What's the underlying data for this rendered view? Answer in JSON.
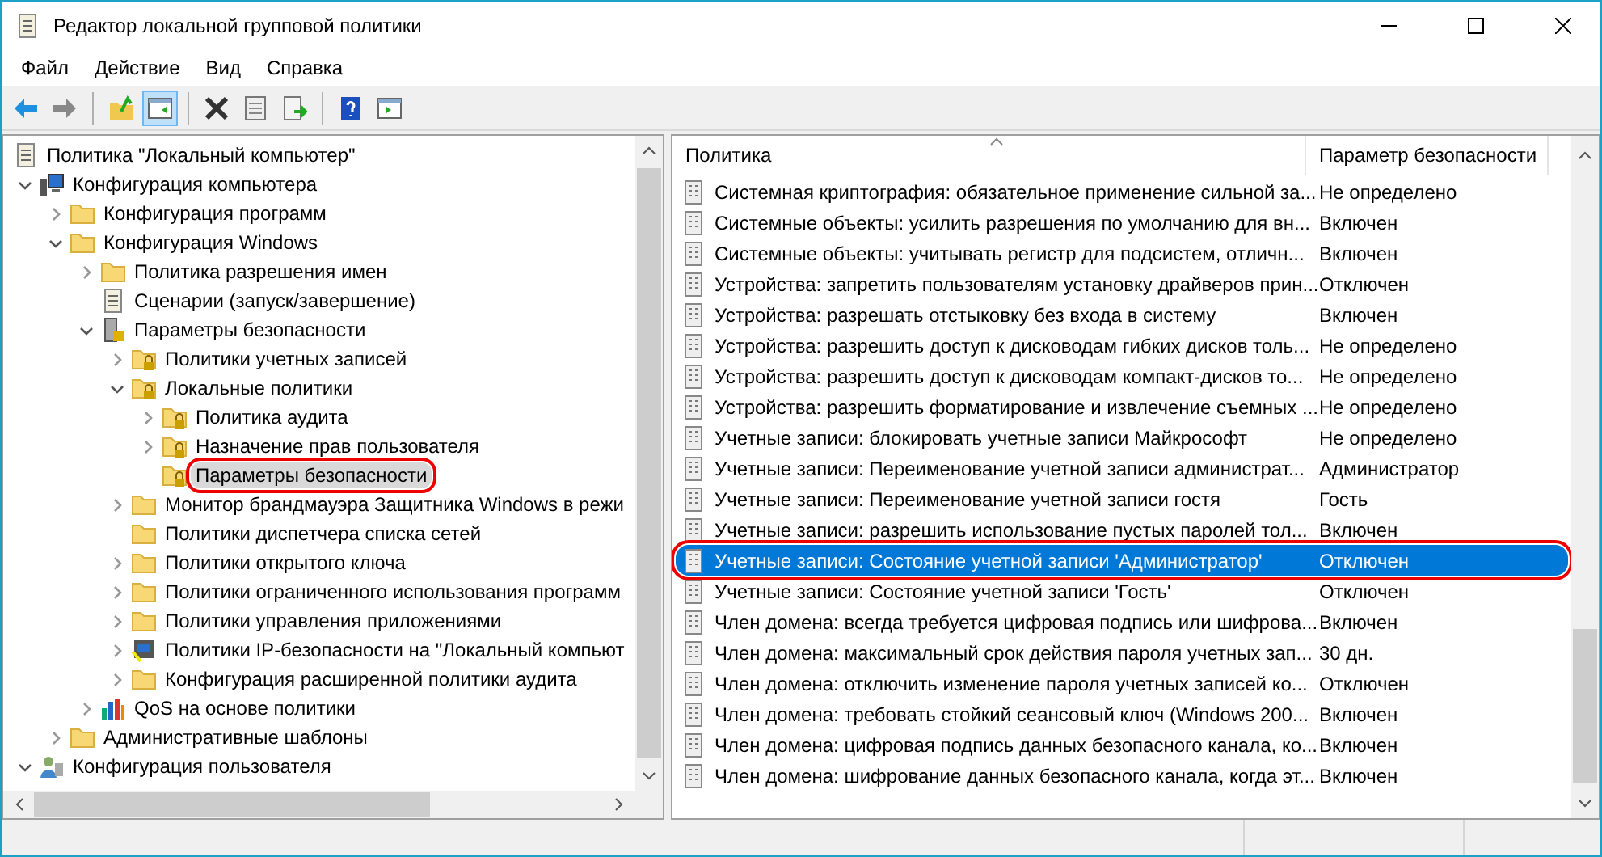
{
  "window": {
    "title": "Редактор локальной групповой политики"
  },
  "menu": [
    "Файл",
    "Действие",
    "Вид",
    "Справка"
  ],
  "toolbar": [
    {
      "kind": "back",
      "pressed": false
    },
    {
      "kind": "forward",
      "pressed": false
    },
    {
      "kind": "separator"
    },
    {
      "kind": "up",
      "pressed": false
    },
    {
      "kind": "tree",
      "pressed": true
    },
    {
      "kind": "separator"
    },
    {
      "kind": "delete",
      "pressed": false
    },
    {
      "kind": "properties",
      "pressed": false
    },
    {
      "kind": "export",
      "pressed": false
    },
    {
      "kind": "separator"
    },
    {
      "kind": "help",
      "pressed": false
    },
    {
      "kind": "actions",
      "pressed": false
    }
  ],
  "tree": [
    {
      "label": "Политика \"Локальный компьютер\"",
      "kind": "doc",
      "selected": false,
      "circled": false,
      "children": [
        {
          "label": "Конфигурация компьютера",
          "kind": "computer",
          "expanded": true,
          "selected": false,
          "circled": false,
          "children": [
            {
              "label": "Конфигурация программ",
              "kind": "folder",
              "expanded": false,
              "selected": false,
              "circled": false
            },
            {
              "label": "Конфигурация Windows",
              "kind": "folder",
              "expanded": true,
              "selected": false,
              "circled": false,
              "children": [
                {
                  "label": "Политика разрешения имен",
                  "kind": "folder",
                  "expanded": false,
                  "selected": false,
                  "circled": false
                },
                {
                  "label": "Сценарии (запуск/завершение)",
                  "kind": "script",
                  "selected": false,
                  "circled": false
                },
                {
                  "label": "Параметры безопасности",
                  "kind": "secure",
                  "expanded": true,
                  "selected": false,
                  "circled": false,
                  "children": [
                    {
                      "label": "Политики учетных записей",
                      "kind": "lockfolder",
                      "expanded": false,
                      "selected": false,
                      "circled": false
                    },
                    {
                      "label": "Локальные политики",
                      "kind": "lockfolder",
                      "expanded": true,
                      "selected": false,
                      "circled": false,
                      "children": [
                        {
                          "label": "Политика аудита",
                          "kind": "lockfolder",
                          "expanded": false,
                          "selected": false,
                          "circled": false
                        },
                        {
                          "label": "Назначение прав пользователя",
                          "kind": "lockfolder",
                          "expanded": false,
                          "selected": false,
                          "circled": false
                        },
                        {
                          "label": "Параметры безопасности",
                          "kind": "lockfolder",
                          "selected": true,
                          "circled": true
                        }
                      ]
                    },
                    {
                      "label": "Монитор брандмауэра Защитника Windows в режи",
                      "kind": "folder",
                      "expanded": false,
                      "selected": false,
                      "circled": false
                    },
                    {
                      "label": "Политики диспетчера списка сетей",
                      "kind": "folder",
                      "selected": false,
                      "circled": false
                    },
                    {
                      "label": "Политики открытого ключа",
                      "kind": "folder",
                      "expanded": false,
                      "selected": false,
                      "circled": false
                    },
                    {
                      "label": "Политики ограниченного использования программ",
                      "kind": "folder",
                      "expanded": false,
                      "selected": false,
                      "circled": false
                    },
                    {
                      "label": "Политики управления приложениями",
                      "kind": "folder",
                      "expanded": false,
                      "selected": false,
                      "circled": false
                    },
                    {
                      "label": "Политики IP-безопасности на \"Локальный компьют",
                      "kind": "ip",
                      "expanded": false,
                      "selected": false,
                      "circled": false
                    },
                    {
                      "label": "Конфигурация расширенной политики аудита",
                      "kind": "folder",
                      "expanded": false,
                      "selected": false,
                      "circled": false
                    }
                  ]
                },
                {
                  "label": "QoS на основе политики",
                  "kind": "qos",
                  "expanded": false,
                  "selected": false,
                  "circled": false
                }
              ]
            },
            {
              "label": "Административные шаблоны",
              "kind": "folder",
              "expanded": false,
              "selected": false,
              "circled": false
            }
          ]
        },
        {
          "label": "Конфигурация пользователя",
          "kind": "user",
          "expanded": true,
          "selected": false,
          "circled": false
        }
      ]
    }
  ],
  "list": {
    "columns": [
      "Политика",
      "Параметр безопасности"
    ],
    "rows": [
      {
        "policy": "Системная криптография: обязательное применение сильной за...",
        "setting": "Не определено",
        "selected": false,
        "circled": false
      },
      {
        "policy": "Системные объекты: усилить разрешения по умолчанию для вн...",
        "setting": "Включен",
        "selected": false,
        "circled": false
      },
      {
        "policy": "Системные объекты: учитывать регистр для подсистем, отличн...",
        "setting": "Включен",
        "selected": false,
        "circled": false
      },
      {
        "policy": "Устройства: запретить пользователям установку драйверов прин...",
        "setting": "Отключен",
        "selected": false,
        "circled": false
      },
      {
        "policy": "Устройства: разрешать отстыковку без входа в систему",
        "setting": "Включен",
        "selected": false,
        "circled": false
      },
      {
        "policy": "Устройства: разрешить доступ к дисководам гибких дисков толь...",
        "setting": "Не определено",
        "selected": false,
        "circled": false
      },
      {
        "policy": "Устройства: разрешить доступ к дисководам компакт-дисков то...",
        "setting": "Не определено",
        "selected": false,
        "circled": false
      },
      {
        "policy": "Устройства: разрешить форматирование и извлечение съемных ...",
        "setting": "Не определено",
        "selected": false,
        "circled": false
      },
      {
        "policy": "Учетные записи: блокировать учетные записи Майкрософт",
        "setting": "Не определено",
        "selected": false,
        "circled": false
      },
      {
        "policy": "Учетные записи: Переименование учетной записи администрат...",
        "setting": "Администратор",
        "selected": false,
        "circled": false
      },
      {
        "policy": "Учетные записи: Переименование учетной записи гостя",
        "setting": "Гость",
        "selected": false,
        "circled": false
      },
      {
        "policy": "Учетные записи: разрешить использование пустых паролей тол...",
        "setting": "Включен",
        "selected": false,
        "circled": false
      },
      {
        "policy": "Учетные записи: Состояние учетной записи 'Администратор'",
        "setting": "Отключен",
        "selected": true,
        "circled": true
      },
      {
        "policy": "Учетные записи: Состояние учетной записи 'Гость'",
        "setting": "Отключен",
        "selected": false,
        "circled": false
      },
      {
        "policy": "Член домена: всегда требуется цифровая подпись или шифрова...",
        "setting": "Включен",
        "selected": false,
        "circled": false
      },
      {
        "policy": "Член домена: максимальный срок действия пароля учетных зап...",
        "setting": "30 дн.",
        "selected": false,
        "circled": false
      },
      {
        "policy": "Член домена: отключить изменение пароля учетных записей ко...",
        "setting": "Отключен",
        "selected": false,
        "circled": false
      },
      {
        "policy": "Член домена: требовать стойкий сеансовый ключ (Windows 200...",
        "setting": "Включен",
        "selected": false,
        "circled": false
      },
      {
        "policy": "Член домена: цифровая подпись данных безопасного канала, ко...",
        "setting": "Включен",
        "selected": false,
        "circled": false
      },
      {
        "policy": "Член домена: шифрование данных безопасного канала, когда эт...",
        "setting": "Включен",
        "selected": false,
        "circled": false
      }
    ]
  }
}
